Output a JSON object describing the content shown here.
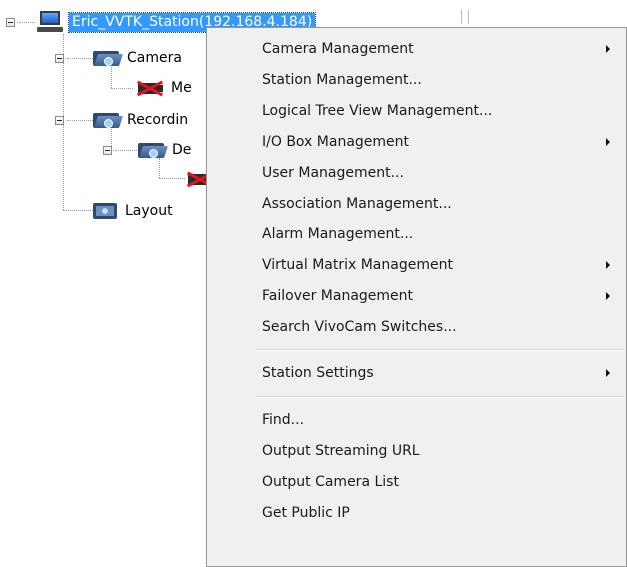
{
  "tree": {
    "root": {
      "label": "Eric_VVTK_Station(192.168.4.184)"
    },
    "camera_group": {
      "label": "Camera"
    },
    "camera_child": {
      "label": "Me"
    },
    "recording_group": {
      "label": "Recordin"
    },
    "recording_sub": {
      "label": "De"
    },
    "layout_group": {
      "label": "Layout"
    }
  },
  "context_menu": {
    "items": [
      {
        "label": "Camera Management",
        "has_submenu": true
      },
      {
        "label": "Station Management...",
        "has_submenu": false
      },
      {
        "label": "Logical Tree View Management...",
        "has_submenu": false
      },
      {
        "label": "I/O Box Management",
        "has_submenu": true
      },
      {
        "label": "User Management...",
        "has_submenu": false
      },
      {
        "label": "Association Management...",
        "has_submenu": false
      },
      {
        "label": "Alarm Management...",
        "has_submenu": false
      },
      {
        "label": "Virtual Matrix Management",
        "has_submenu": true
      },
      {
        "label": "Failover Management",
        "has_submenu": true
      },
      {
        "label": "Search VivoCam Switches...",
        "has_submenu": false
      },
      {
        "label": "Station Settings",
        "has_submenu": true
      },
      {
        "label": "Find...",
        "has_submenu": false
      },
      {
        "label": "Output Streaming URL",
        "has_submenu": false
      },
      {
        "label": "Output Camera List",
        "has_submenu": false
      },
      {
        "label": "Get Public IP",
        "has_submenu": false
      }
    ]
  },
  "colors": {
    "selection": "#3399ff",
    "menu_background": "#f0f0f0",
    "menu_border": "#979797",
    "red_cross": "#e0151e"
  }
}
